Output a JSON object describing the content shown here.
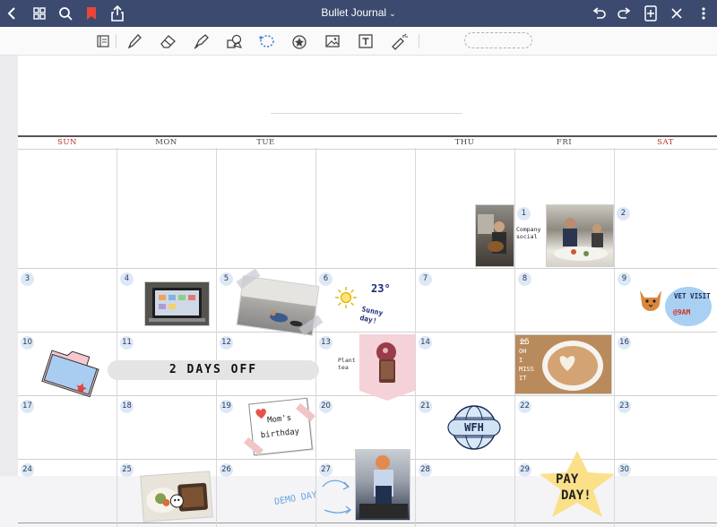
{
  "topbar": {
    "title": "Bullet Journal",
    "title_chevron": "⌄",
    "icons": [
      "back-icon",
      "grid-icon",
      "search-icon",
      "bookmark-icon",
      "share-icon",
      "undo-icon",
      "redo-icon",
      "add-page-icon",
      "close-icon",
      "more-icon"
    ],
    "bookmark_color": "#e8463a"
  },
  "toolbar": {
    "tools": [
      "page-layout-icon",
      "pen-icon",
      "eraser-icon",
      "highlighter-icon",
      "shapes-icon",
      "lasso-icon",
      "elements-icon",
      "image-icon",
      "text-box-icon",
      "laser-pointer-icon"
    ]
  },
  "calendar": {
    "days": [
      "SUN",
      "MON",
      "TUE",
      "",
      "THU",
      "FRI",
      "SAT"
    ],
    "weekend_color": "#b5302b",
    "numbers": {
      "r0": [
        "",
        "",
        "",
        "",
        "",
        "1",
        "2"
      ],
      "r1": [
        "3",
        "4",
        "5",
        "6",
        "7",
        "8",
        "9"
      ],
      "r2": [
        "10",
        "11",
        "12",
        "13",
        "14",
        "15",
        "16"
      ],
      "r3": [
        "17",
        "18",
        "19",
        "20",
        "21",
        "22",
        "23"
      ],
      "r4": [
        "24",
        "25",
        "26",
        "27",
        "28",
        "29",
        "30"
      ]
    },
    "stickers": {
      "company_social": "Company social",
      "weather_temp": "23°",
      "weather_text": "Sunny day!",
      "vet_visit": "VET VISIT",
      "vet_time": "@9AM",
      "days_off": "2 DAYS OFF",
      "plant_tea": "Plant tea",
      "moms_birthday_1": "Mom's",
      "moms_birthday_2": "birthday",
      "wfh": "WFH",
      "demo_day": "DEMO DAY",
      "pay_day_1": "PAY",
      "pay_day_2": "DAY!",
      "latte_text_1": "15",
      "latte_text_2": "OH",
      "latte_text_3": "I",
      "latte_text_4": "MISS",
      "latte_text_5": "IT"
    }
  }
}
